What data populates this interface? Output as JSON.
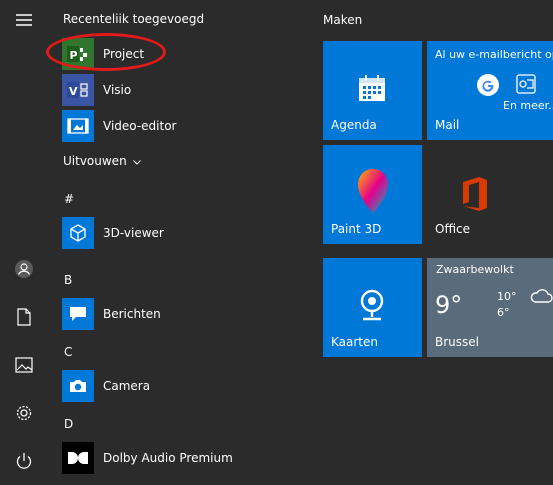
{
  "sidebar": {
    "icons": [
      "hamburger-menu-icon",
      "user-account-icon",
      "documents-icon",
      "pictures-icon",
      "settings-icon",
      "power-icon"
    ]
  },
  "applist": {
    "recently_added_header": "Recenteliik toegevoegd",
    "recent": [
      {
        "label": "Project",
        "icon": "project-icon",
        "color": "#31752f"
      },
      {
        "label": "Visio",
        "icon": "visio-icon",
        "color": "#3955a3"
      },
      {
        "label": "Video-editor",
        "icon": "video-editor-icon",
        "color": "#0078d7"
      }
    ],
    "expand_label": "Uitvouwen",
    "groups": [
      {
        "letter": "#",
        "apps": [
          {
            "label": "3D-viewer",
            "icon": "3d-viewer-icon",
            "color": "#0078d7"
          }
        ]
      },
      {
        "letter": "B",
        "apps": [
          {
            "label": "Berichten",
            "icon": "berichten-icon",
            "color": "#0078d7"
          }
        ]
      },
      {
        "letter": "C",
        "apps": [
          {
            "label": "Camera",
            "icon": "camera-icon",
            "color": "#0078d7"
          }
        ]
      },
      {
        "letter": "D",
        "apps": [
          {
            "label": "Dolby Audio Premium",
            "icon": "dolby-icon",
            "color": "#000000"
          }
        ]
      }
    ]
  },
  "tiles": {
    "group_title": "Maken",
    "agenda": "Agenda",
    "mail": {
      "label": "Mail",
      "text": "Al uw e-mailbericht op",
      "more": "En meer..."
    },
    "paint3d": "Paint 3D",
    "office": "Office",
    "kaarten": "Kaarten",
    "weather": {
      "condition": "Zwaarbewolkt",
      "temp": "9°",
      "high": "10°",
      "low": "6°",
      "city": "Brussel"
    }
  },
  "colors": {
    "background": "#2b2b2b",
    "accent": "#0078d7",
    "highlight": "#e11a1a"
  }
}
